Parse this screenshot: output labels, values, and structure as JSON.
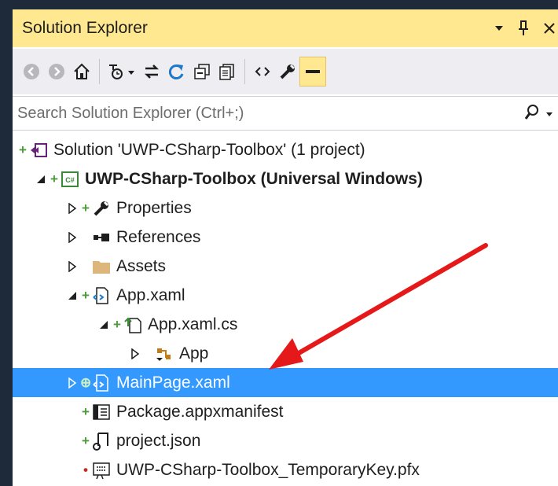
{
  "panel": {
    "title": "Solution Explorer"
  },
  "toolbar": {
    "buttons": [
      "back-icon",
      "forward-icon",
      "home-icon",
      "history-icon",
      "sync-icon",
      "refresh-icon",
      "collapse-all-icon",
      "show-all-files-icon",
      "view-code-icon",
      "properties-icon",
      "preview-icon"
    ]
  },
  "search": {
    "placeholder": "Search Solution Explorer (Ctrl+;)"
  },
  "tree": {
    "items": [
      {
        "label": "Solution 'UWP-CSharp-Toolbox' (1 project)",
        "icon": "solution-icon"
      },
      {
        "label": "UWP-CSharp-Toolbox (Universal Windows)",
        "icon": "csharp-project-icon"
      },
      {
        "label": "Properties",
        "icon": "wrench-icon"
      },
      {
        "label": "References",
        "icon": "references-icon"
      },
      {
        "label": "Assets",
        "icon": "folder-icon"
      },
      {
        "label": "App.xaml",
        "icon": "xaml-file-icon"
      },
      {
        "label": "App.xaml.cs",
        "icon": "csharp-file-icon"
      },
      {
        "label": "App",
        "icon": "class-icon"
      },
      {
        "label": "MainPage.xaml",
        "icon": "xaml-file-icon"
      },
      {
        "label": "Package.appxmanifest",
        "icon": "manifest-icon"
      },
      {
        "label": "project.json",
        "icon": "json-file-icon"
      },
      {
        "label": "UWP-CSharp-Toolbox_TemporaryKey.pfx",
        "icon": "certificate-icon"
      }
    ]
  },
  "colors": {
    "title_bar": "#ffe88f",
    "selection": "#3399ff",
    "annotation_arrow": "#e51919"
  }
}
